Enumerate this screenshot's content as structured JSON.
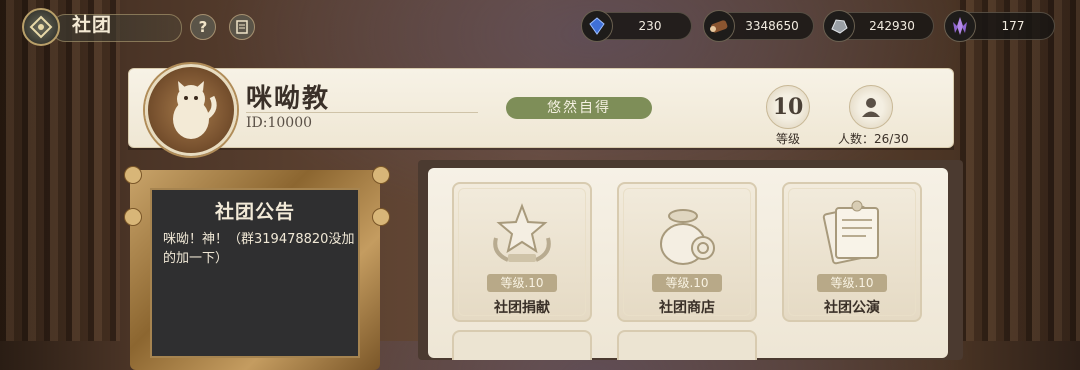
{
  "header": {
    "title": "社团",
    "help_label": "?",
    "resources": [
      {
        "icon": "blue-gem-icon",
        "value": "230"
      },
      {
        "icon": "wood-log-icon",
        "value": "3348650"
      },
      {
        "icon": "stone-ore-icon",
        "value": "242930"
      },
      {
        "icon": "purple-crystal-icon",
        "value": "177"
      }
    ]
  },
  "club": {
    "name": "咪呦教",
    "id": "ID:10000",
    "motto": "悠然自得",
    "level_value": "10",
    "level_label": "等级",
    "members_label": "人数：26/30"
  },
  "notice": {
    "title": "社团公告",
    "text": "咪呦！神！（群319478820没加的加一下）"
  },
  "functions": [
    {
      "level": "等级.10",
      "label": "社团捐献",
      "icon": "donation-star-icon"
    },
    {
      "level": "等级.10",
      "label": "社团商店",
      "icon": "shop-bag-icon"
    },
    {
      "level": "等级.10",
      "label": "社团公演",
      "icon": "performance-script-icon"
    }
  ],
  "colors": {
    "accent_green": "#7e8e58",
    "panel_bg": "#f6f1e6",
    "frame_gold": "#c49c60"
  }
}
